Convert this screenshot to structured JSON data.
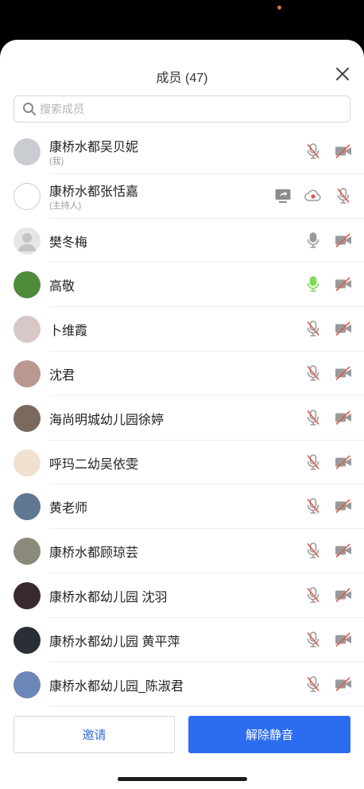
{
  "panel": {
    "title": "成员 (47)"
  },
  "search": {
    "placeholder": "搜索成员"
  },
  "members": [
    {
      "name": "康桥水都吴贝妮",
      "sub": "(我)",
      "mic": "muted",
      "cam": "off",
      "avatar_color": "#c9cdd2"
    },
    {
      "name": "康桥水都张恬嘉",
      "sub": "(主持人)",
      "share": true,
      "record": true,
      "mic": "muted",
      "avatar_color": "#ffffff"
    },
    {
      "name": "樊冬梅",
      "sub": "",
      "mic": "on",
      "cam": "off",
      "avatar_color": "#e6e6e6"
    },
    {
      "name": "高敬",
      "sub": "",
      "mic": "speaking",
      "cam": "off",
      "avatar_color": "#4f8c3a"
    },
    {
      "name": "卜维霞",
      "sub": "",
      "mic": "muted",
      "cam": "off",
      "avatar_color": "#d8c7c7"
    },
    {
      "name": "沈君",
      "sub": "",
      "mic": "muted",
      "cam": "off",
      "avatar_color": "#b89890"
    },
    {
      "name": "海尚明城幼儿园徐婷",
      "sub": "",
      "mic": "muted",
      "cam": "off",
      "avatar_color": "#7a6a5e"
    },
    {
      "name": "呼玛二幼吴依雯",
      "sub": "",
      "mic": "muted",
      "cam": "off",
      "avatar_color": "#f0e0d0"
    },
    {
      "name": "黄老师",
      "sub": "",
      "mic": "muted",
      "cam": "off",
      "avatar_color": "#5f7890"
    },
    {
      "name": "康桥水都顾琼芸",
      "sub": "",
      "mic": "muted",
      "cam": "off",
      "avatar_color": "#8b8a7a"
    },
    {
      "name": "康桥水都幼儿园 沈羽",
      "sub": "",
      "mic": "muted",
      "cam": "off",
      "avatar_color": "#3a2a30"
    },
    {
      "name": "康桥水都幼儿园 黄平萍",
      "sub": "",
      "mic": "muted",
      "cam": "off",
      "avatar_color": "#2a2e38"
    },
    {
      "name": "康桥水都幼儿园_陈淑君",
      "sub": "",
      "mic": "muted",
      "cam": "off",
      "avatar_color": "#6c86b8"
    }
  ],
  "footer": {
    "invite_label": "邀请",
    "unmute_label": "解除静音"
  },
  "colors": {
    "accent": "#2c6df0",
    "mute_red": "#e05a4a",
    "speaking_green": "#7ed957"
  }
}
